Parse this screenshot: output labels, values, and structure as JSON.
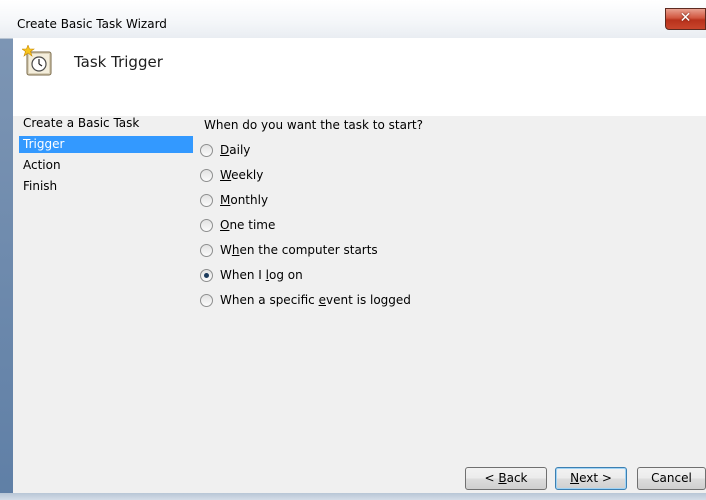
{
  "window": {
    "title": "Create Basic Task Wizard",
    "close_glyph": "✕"
  },
  "header": {
    "title": "Task Trigger",
    "icon": "clock-task-icon"
  },
  "nav": {
    "items": [
      {
        "label": "Create a Basic Task",
        "selected": false
      },
      {
        "label": "Trigger",
        "selected": true
      },
      {
        "label": "Action",
        "selected": false
      },
      {
        "label": "Finish",
        "selected": false
      }
    ]
  },
  "trigger": {
    "prompt": "When do you want the task to start?",
    "options": [
      {
        "pre": "",
        "key": "D",
        "post": "aily",
        "checked": false
      },
      {
        "pre": "",
        "key": "W",
        "post": "eekly",
        "checked": false
      },
      {
        "pre": "",
        "key": "M",
        "post": "onthly",
        "checked": false
      },
      {
        "pre": "",
        "key": "O",
        "post": "ne time",
        "checked": false
      },
      {
        "pre": "W",
        "key": "h",
        "post": "en the computer starts",
        "checked": false
      },
      {
        "pre": "When I ",
        "key": "l",
        "post": "og on",
        "checked": true
      },
      {
        "pre": "When a specific ",
        "key": "e",
        "post": "vent is logged",
        "checked": false
      }
    ]
  },
  "buttons": {
    "back": {
      "pre": "< ",
      "key": "B",
      "post": "ack"
    },
    "next": {
      "pre": "",
      "key": "N",
      "post": "ext >"
    },
    "cancel": {
      "label": "Cancel"
    }
  }
}
